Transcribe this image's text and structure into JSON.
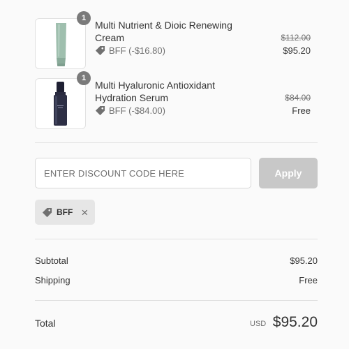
{
  "items": [
    {
      "name": "Multi Nutrient & Dioic Renewing Cream",
      "quantity": "1",
      "discount_label": "BFF (-$16.80)",
      "original_price": "$112.00",
      "final_price": "$95.20",
      "image_icon": "cream-tube-thumbnail"
    },
    {
      "name": "Multi Hyaluronic Antioxidant Hydration Serum",
      "quantity": "1",
      "discount_label": "BFF (-$84.00)",
      "original_price": "$84.00",
      "final_price": "Free",
      "image_icon": "serum-bottle-thumbnail"
    }
  ],
  "discount": {
    "placeholder": "ENTER DISCOUNT CODE HERE",
    "apply_label": "Apply",
    "applied_code": "BFF",
    "tag_icon": "tag-icon",
    "remove_icon": "close-icon"
  },
  "summary": {
    "subtotal_label": "Subtotal",
    "subtotal_value": "$95.20",
    "shipping_label": "Shipping",
    "shipping_value": "Free",
    "total_label": "Total",
    "currency": "USD",
    "total_value": "$95.20"
  },
  "colors": {
    "badge": "#7a7a7a",
    "apply_disabled": "#c8c8c8",
    "tag_bg": "#e6e6e6",
    "text": "#333333",
    "muted": "#707070",
    "cream_tube": "#9fbfae",
    "serum_bottle": "#2d2f45"
  }
}
